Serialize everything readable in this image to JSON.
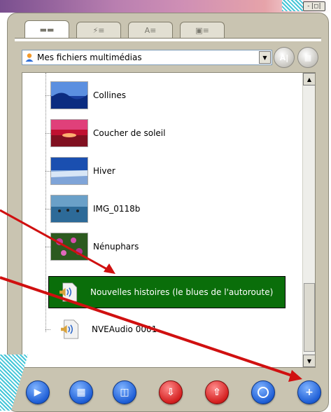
{
  "window": {
    "controls_label": "-|□|"
  },
  "tabs": [
    {
      "label": "▬▬",
      "icon": "list-icon"
    },
    {
      "label": "⚡≡",
      "icon": "effects-icon"
    },
    {
      "label": "A≡",
      "icon": "titles-icon"
    },
    {
      "label": "▣≡",
      "icon": "transitions-icon"
    }
  ],
  "source": {
    "selected": "Mes fichiers multimédias"
  },
  "list": {
    "items": [
      {
        "name": "Collines"
      },
      {
        "name": "Coucher de soleil"
      },
      {
        "name": "Hiver"
      },
      {
        "name": "IMG_0118b"
      },
      {
        "name": "Nénuphars"
      },
      {
        "name": "Nouvelles histoires (le blues de l'autoroute)"
      },
      {
        "name": "NVEAudio 0001"
      }
    ]
  },
  "toolbar": {
    "buttons": [
      {
        "icon": "play-icon",
        "color": "blue"
      },
      {
        "icon": "film-icon",
        "color": "blue"
      },
      {
        "icon": "save-icon",
        "color": "blue"
      },
      {
        "icon": "import-icon",
        "color": "red"
      },
      {
        "icon": "export-icon",
        "color": "red"
      },
      {
        "icon": "target-icon",
        "color": "blue"
      },
      {
        "icon": "add-icon",
        "color": "blue"
      }
    ]
  },
  "colors": {
    "selection": "#0a6e0a",
    "arrow": "#d01010",
    "panel": "#c9c4b1"
  }
}
